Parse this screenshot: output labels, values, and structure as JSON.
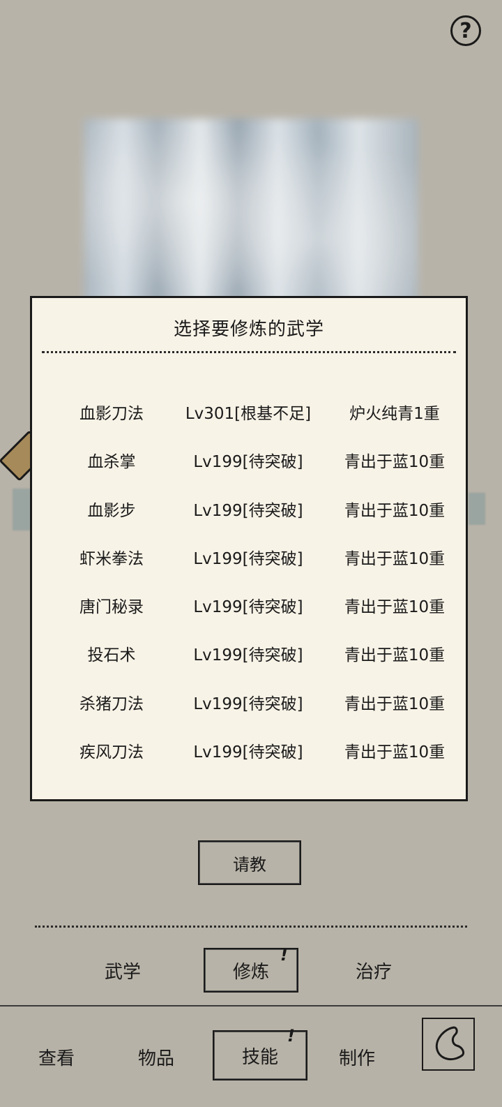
{
  "help_icon": "question-mark-icon",
  "dialog": {
    "title": "选择要修炼的武学",
    "skills": [
      {
        "name": "血影刀法",
        "level": "Lv301[根基不足]",
        "stage": "炉火纯青1重"
      },
      {
        "name": "血杀掌",
        "level": "Lv199[待突破]",
        "stage": "青出于蓝10重"
      },
      {
        "name": "血影步",
        "level": "Lv199[待突破]",
        "stage": "青出于蓝10重"
      },
      {
        "name": "虾米拳法",
        "level": "Lv199[待突破]",
        "stage": "青出于蓝10重"
      },
      {
        "name": "唐门秘录",
        "level": "Lv199[待突破]",
        "stage": "青出于蓝10重"
      },
      {
        "name": "投石术",
        "level": "Lv199[待突破]",
        "stage": "青出于蓝10重"
      },
      {
        "name": "杀猪刀法",
        "level": "Lv199[待突破]",
        "stage": "青出于蓝10重"
      },
      {
        "name": "疾风刀法",
        "level": "Lv199[待突破]",
        "stage": "青出于蓝10重"
      }
    ]
  },
  "consult_button": "请教",
  "skill_tabs": {
    "martial": "武学",
    "cultivate": "修炼",
    "cultivate_alert": "!",
    "heal": "治疗"
  },
  "bottom_nav": {
    "view": "查看",
    "items": "物品",
    "skills": "技能",
    "skills_alert": "!",
    "craft": "制作",
    "back_icon": "back-arrow-icon"
  },
  "colors": {
    "background": "#b8b3a8",
    "dialog_bg": "#f8f3e7",
    "ink": "#1a1a1a"
  }
}
